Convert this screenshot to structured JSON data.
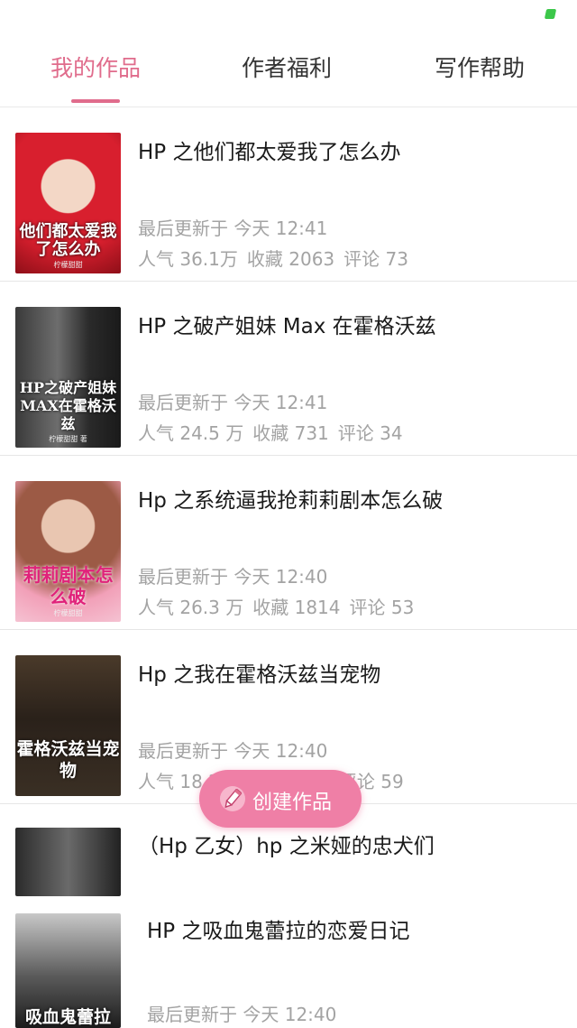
{
  "tabs": [
    {
      "label": "我的作品",
      "active": true
    },
    {
      "label": "作者福利",
      "active": false
    },
    {
      "label": "写作帮助",
      "active": false
    }
  ],
  "works": [
    {
      "title": "HP 之他们都太爱我了怎么办",
      "updated": "最后更新于 今天 12:41",
      "popularity": "人气 36.1万",
      "favorites": "收藏 2063",
      "comments": "评论 73",
      "cover_text": "他们都太爱我了怎么办",
      "cover_author": "柠檬甜甜"
    },
    {
      "title": "HP 之破产姐妹 Max 在霍格沃兹",
      "updated": "最后更新于 今天 12:41",
      "popularity": "人气 24.5 万",
      "favorites": "收藏 731",
      "comments": "评论 34",
      "cover_text": "HP之破产姐妹MAX在霍格沃兹",
      "cover_author": "柠檬甜甜 著"
    },
    {
      "title": "Hp 之系统逼我抢莉莉剧本怎么破",
      "updated": "最后更新于 今天 12:40",
      "popularity": "人气 26.3 万",
      "favorites": "收藏 1814",
      "comments": "评论 53",
      "cover_text": "莉莉剧本怎么破",
      "cover_author": "柠檬甜甜"
    },
    {
      "title": "Hp 之我在霍格沃兹当宠物",
      "updated": "最后更新于 今天 12:40",
      "popularity": "人气 18.2",
      "favorites": "",
      "comments": "评论 59",
      "cover_text": "霍格沃兹当宠物",
      "cover_author": ""
    }
  ],
  "partial_works": [
    {
      "title": "（Hp 乙女）hp 之米娅的忠犬们"
    },
    {
      "title": "HP 之吸血鬼蕾拉的恋爱日记",
      "updated": "最后更新于 今天 12:40",
      "cover_text": "吸血鬼蕾拉"
    }
  ],
  "fab": {
    "label": "创建作品",
    "icon": "pencil-icon"
  },
  "colors": {
    "accent": "#e06c8c",
    "fab": "#ef7fa6",
    "meta_text": "#a3a3a3"
  }
}
